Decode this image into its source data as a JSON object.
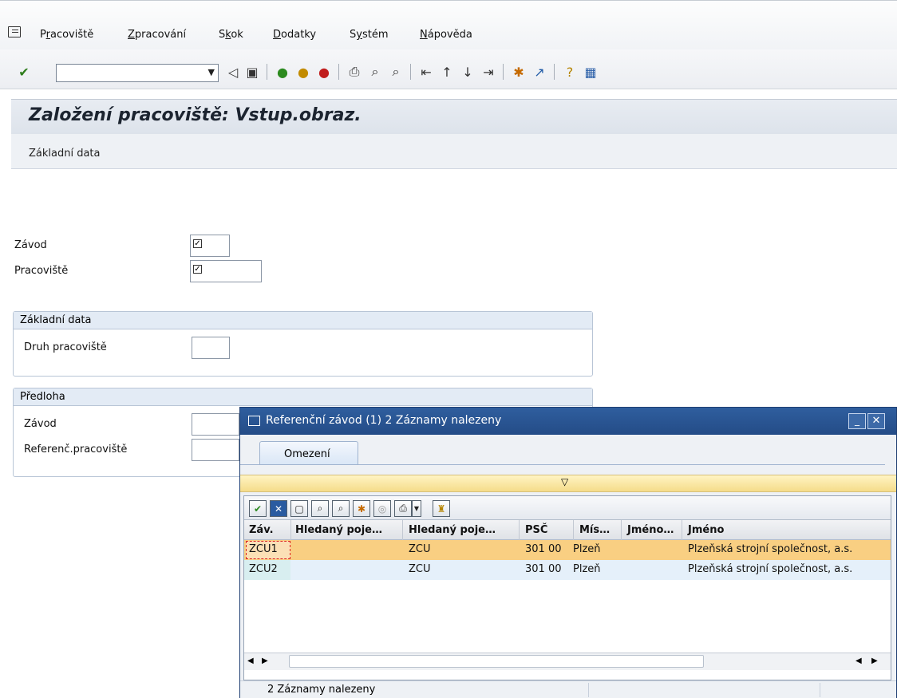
{
  "menu": {
    "items": [
      {
        "pre": "P",
        "acc": "r",
        "post": "acoviště"
      },
      {
        "pre": "",
        "acc": "Z",
        "post": "pracování"
      },
      {
        "pre": "S",
        "acc": "k",
        "post": "ok"
      },
      {
        "pre": "",
        "acc": "D",
        "post": "odatky"
      },
      {
        "pre": "S",
        "acc": "y",
        "post": "stém"
      },
      {
        "pre": "",
        "acc": "N",
        "post": "ápověda"
      }
    ]
  },
  "toolbar": {
    "command_value": "",
    "icons": [
      "enter-check-icon",
      "back-arrow-icon",
      "save-icon",
      "back-green-icon",
      "exit-yellow-icon",
      "cancel-red-icon",
      "print-icon",
      "find-icon",
      "find-next-icon",
      "first-page-icon",
      "prev-page-icon",
      "next-page-icon",
      "last-page-icon",
      "create-session-icon",
      "shortcut-icon",
      "help-icon",
      "layout-icon"
    ]
  },
  "title": "Založení pracoviště: Vstup.obraz.",
  "app_toolbar": {
    "basic_data_button": "Základní data"
  },
  "fields": {
    "plant_label": "Závod",
    "workcenter_label": "Pracoviště",
    "basic_group_title": "Základní data",
    "wc_category_label": "Druh pracoviště",
    "template_group_title": "Předloha",
    "tpl_plant_label": "Závod",
    "ref_wc_label": "Referenč.pracoviště"
  },
  "dialog": {
    "title": "Referenční závod (1)    2 Záznamy nalezeny",
    "tab_label": "Omezení",
    "expander": "▽",
    "columns": [
      "Záv.",
      "Hledaný poje…",
      "Hledaný poje…",
      "PSČ",
      "Mís…",
      "Jméno…",
      "Jméno"
    ],
    "rows": [
      {
        "plant": "ZCU1",
        "search1": "",
        "search2": "ZCU",
        "zip": "301 00",
        "city": "Plzeň",
        "name1": "",
        "name": "Plzeňská strojní společnost, a.s."
      },
      {
        "plant": "ZCU2",
        "search1": "",
        "search2": "ZCU",
        "zip": "301 00",
        "city": "Plzeň",
        "name1": "",
        "name": "Plzeňská strojní společnost, a.s."
      }
    ],
    "status": "2 Záznamy nalezeny"
  },
  "colors": {
    "selected_row": "#f9cf82",
    "second_row": "#e5f0fa",
    "key_cell": "#d8eef0",
    "dialog_title": "#2a5592"
  }
}
